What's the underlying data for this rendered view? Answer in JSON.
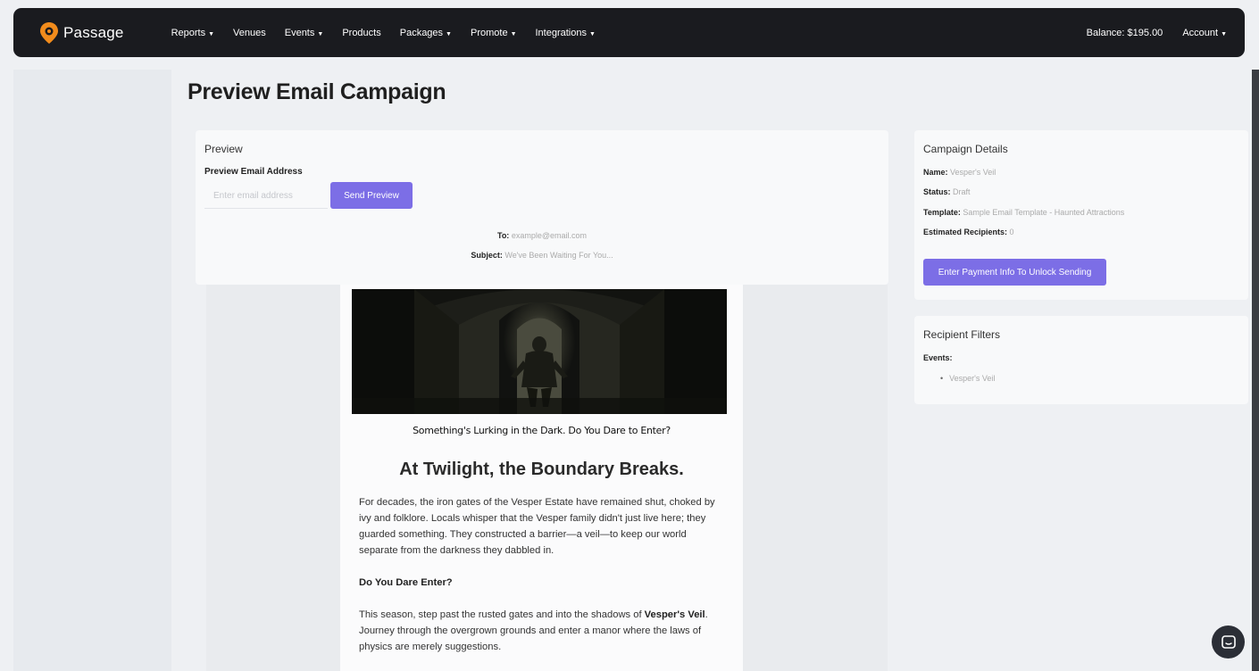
{
  "nav": {
    "brand": "Passage",
    "items": [
      {
        "label": "Reports",
        "dropdown": true
      },
      {
        "label": "Venues",
        "dropdown": false
      },
      {
        "label": "Events",
        "dropdown": true
      },
      {
        "label": "Products",
        "dropdown": false
      },
      {
        "label": "Packages",
        "dropdown": true
      },
      {
        "label": "Promote",
        "dropdown": true
      },
      {
        "label": "Integrations",
        "dropdown": true
      }
    ],
    "balance": "Balance: $195.00",
    "account": "Account"
  },
  "page": {
    "title": "Preview Email Campaign"
  },
  "preview": {
    "title": "Preview",
    "email_label": "Preview Email Address",
    "email_placeholder": "Enter email address",
    "send_label": "Send Preview",
    "to_label": "To:",
    "to_value": "example@email.com",
    "subject_label": "Subject:",
    "subject_value": "We've Been Waiting For You..."
  },
  "email": {
    "tagline": "Something's Lurking in the Dark. Do You Dare to Enter?",
    "headline": "At Twilight, the Boundary Breaks.",
    "para1": "For decades, the iron gates of the Vesper Estate have remained shut, choked by ivy and folklore. Locals whisper that the Vesper family didn't just live here; they guarded something. They constructed a barrier—a veil—to keep our world separate from the darkness they dabbled in.",
    "subheading": "Do You Dare Enter?",
    "para2_start": "This season, step past the rusted gates and into the shadows of ",
    "para2_bold": "Vesper's Veil",
    "para2_end": ". Journey through the overgrown grounds and enter a manor where the laws of physics are merely suggestions."
  },
  "details": {
    "title": "Campaign Details",
    "name_label": "Name:",
    "name_value": "Vesper's Veil",
    "status_label": "Status:",
    "status_value": "Draft",
    "template_label": "Template:",
    "template_value": "Sample Email Template - Haunted Attractions",
    "recipients_label": "Estimated Recipients:",
    "recipients_value": "0",
    "unlock_label": "Enter Payment Info To Unlock Sending"
  },
  "filters": {
    "title": "Recipient Filters",
    "events_label": "Events:",
    "events": [
      "Vesper's Veil"
    ]
  },
  "colors": {
    "accent": "#7c6ee6",
    "navbar": "#1a1b1f",
    "brand_orange": "#f28c1c"
  },
  "icons": {
    "brand": "location-pin-logo-icon",
    "caret": "caret-down-icon",
    "chat": "chat-bubble-icon"
  }
}
